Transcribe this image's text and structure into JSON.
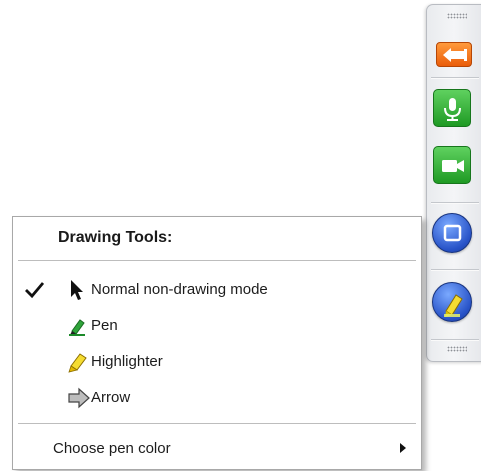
{
  "toolbar": {
    "buttons": [
      {
        "name": "back",
        "icon": "exit-arrow-icon",
        "color": "#ea5d0a"
      },
      {
        "name": "microphone",
        "icon": "microphone-icon",
        "color": "#1f9a24"
      },
      {
        "name": "camera",
        "icon": "video-camera-icon",
        "color": "#1f9a24"
      },
      {
        "name": "stop",
        "icon": "stop-square-icon",
        "color": "#2752c7"
      },
      {
        "name": "drawing-tools",
        "icon": "highlighter-icon",
        "color": "#2752c7"
      }
    ]
  },
  "menu": {
    "title": "Drawing Tools:",
    "items": [
      {
        "label": "Normal non-drawing mode",
        "icon": "cursor-arrow-icon",
        "checked": true
      },
      {
        "label": "Pen",
        "icon": "pen-icon",
        "checked": false
      },
      {
        "label": "Highlighter",
        "icon": "highlighter-icon",
        "checked": false
      },
      {
        "label": "Arrow",
        "icon": "arrow-icon",
        "checked": false
      }
    ],
    "color_item": {
      "label": "Choose pen color",
      "has_submenu": true
    }
  }
}
